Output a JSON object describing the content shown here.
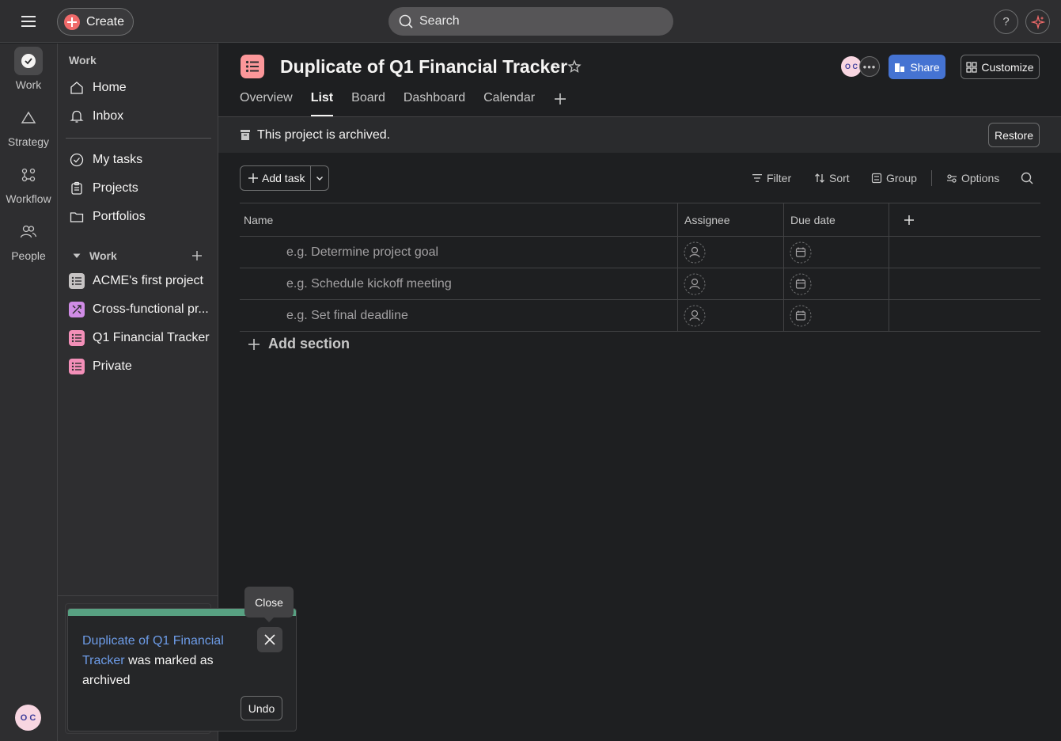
{
  "topbar": {
    "create_label": "Create",
    "search_placeholder": "Search",
    "help_label": "?"
  },
  "rail": {
    "items": [
      {
        "label": "Work",
        "icon": "check-circle-icon"
      },
      {
        "label": "Strategy",
        "icon": "triangle-icon"
      },
      {
        "label": "Workflow",
        "icon": "workflow-icon"
      },
      {
        "label": "People",
        "icon": "people-icon"
      }
    ],
    "avatar_initials": "O C"
  },
  "sidebar": {
    "heading": "Work",
    "nav": [
      {
        "label": "Home",
        "icon": "home-icon"
      },
      {
        "label": "Inbox",
        "icon": "bell-icon"
      }
    ],
    "nav2": [
      {
        "label": "My tasks",
        "icon": "check-circle-icon"
      },
      {
        "label": "Projects",
        "icon": "clipboard-icon"
      },
      {
        "label": "Portfolios",
        "icon": "folder-icon"
      }
    ],
    "section_label": "Work",
    "projects": [
      {
        "label": "ACME's first project",
        "color": "#c7c4c4"
      },
      {
        "label": "Cross-functional pr...",
        "color": "#d08ce6"
      },
      {
        "label": "Q1 Financial Tracker",
        "color": "#f38fb8"
      },
      {
        "label": "Private",
        "color": "#f38fb8"
      }
    ]
  },
  "header": {
    "title": "Duplicate of Q1 Financial Tracker",
    "avatar_initials": "O C",
    "share_label": "Share",
    "customize_label": "Customize",
    "tabs": [
      "Overview",
      "List",
      "Board",
      "Dashboard",
      "Calendar"
    ],
    "active_tab": "List"
  },
  "archived": {
    "message": "This project is archived.",
    "restore_label": "Restore"
  },
  "toolbar": {
    "add_task_label": "Add task",
    "filter_label": "Filter",
    "sort_label": "Sort",
    "group_label": "Group",
    "options_label": "Options"
  },
  "table": {
    "columns": [
      "Name",
      "Assignee",
      "Due date"
    ],
    "rows": [
      {
        "name": "e.g. Determine project goal"
      },
      {
        "name": "e.g. Schedule kickoff meeting"
      },
      {
        "name": "e.g. Set final deadline"
      }
    ],
    "add_section_label": "Add section"
  },
  "toast": {
    "link_text": "Duplicate of Q1 Financial Tracker",
    "message_rest": " was marked as archived",
    "undo_label": "Undo",
    "tooltip": "Close",
    "bar_color": "#58a182"
  },
  "colors": {
    "accent_blue": "#4573d2",
    "project_pink": "#fc979a",
    "create_red": "#f06a6a"
  }
}
